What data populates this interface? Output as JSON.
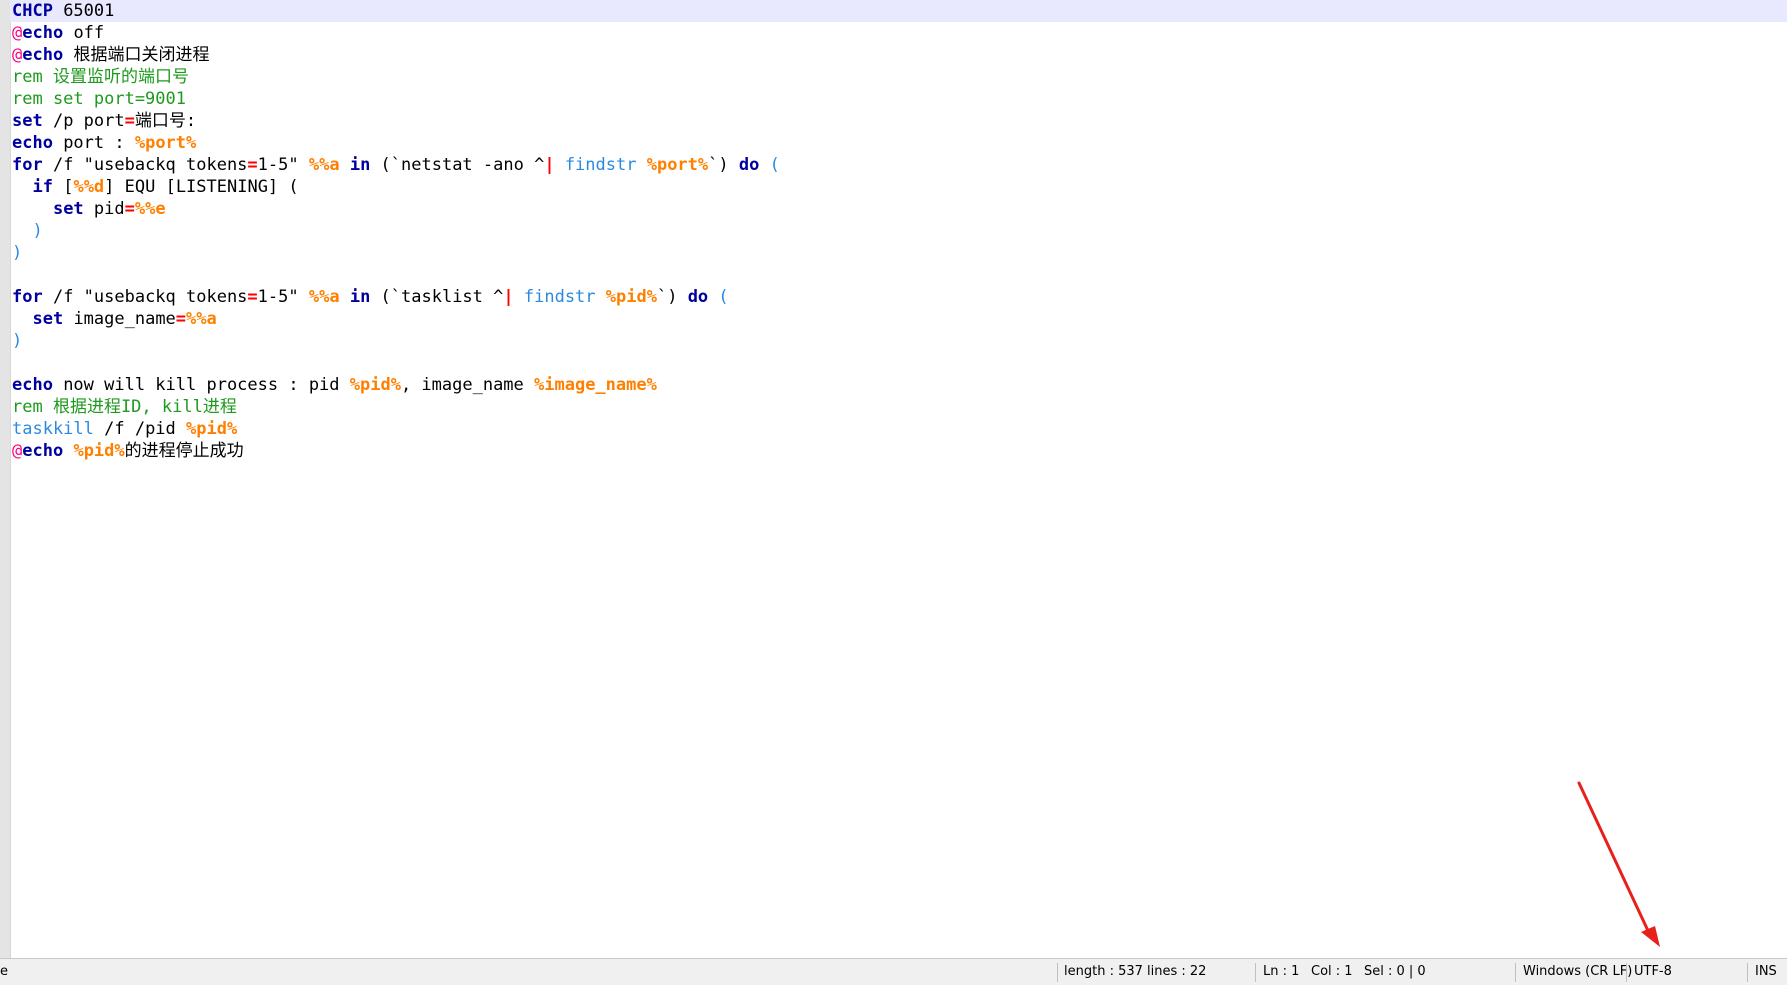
{
  "editor": {
    "lines": [
      [
        {
          "t": "CHCP",
          "c": "kw"
        },
        {
          "t": " 65001",
          "c": ""
        }
      ],
      [
        {
          "t": "@",
          "c": "at"
        },
        {
          "t": "echo",
          "c": "kw"
        },
        {
          "t": " off",
          "c": ""
        }
      ],
      [
        {
          "t": "@",
          "c": "at"
        },
        {
          "t": "echo",
          "c": "kw"
        },
        {
          "t": " 根据端口关闭进程",
          "c": ""
        }
      ],
      [
        {
          "t": "rem 设置监听的端口号",
          "c": "rem"
        }
      ],
      [
        {
          "t": "rem set port=9001",
          "c": "rem"
        }
      ],
      [
        {
          "t": "set",
          "c": "kw"
        },
        {
          "t": " /p port",
          "c": ""
        },
        {
          "t": "=",
          "c": "op"
        },
        {
          "t": "端口号:",
          "c": ""
        }
      ],
      [
        {
          "t": "echo",
          "c": "kw"
        },
        {
          "t": " port : ",
          "c": ""
        },
        {
          "t": "%port%",
          "c": "var"
        }
      ],
      [
        {
          "t": "for",
          "c": "kw"
        },
        {
          "t": " /f \"usebackq tokens",
          "c": ""
        },
        {
          "t": "=",
          "c": "op"
        },
        {
          "t": "1-5\" ",
          "c": ""
        },
        {
          "t": "%%a",
          "c": "var"
        },
        {
          "t": " ",
          "c": ""
        },
        {
          "t": "in",
          "c": "kw"
        },
        {
          "t": " (`netstat -ano ^",
          "c": ""
        },
        {
          "t": "|",
          "c": "pipe"
        },
        {
          "t": " ",
          "c": ""
        },
        {
          "t": "findstr",
          "c": "cmd"
        },
        {
          "t": " ",
          "c": ""
        },
        {
          "t": "%port%",
          "c": "var"
        },
        {
          "t": "`) ",
          "c": ""
        },
        {
          "t": "do",
          "c": "kw"
        },
        {
          "t": " ",
          "c": ""
        },
        {
          "t": "(",
          "c": "par"
        }
      ],
      [
        {
          "t": "  ",
          "c": ""
        },
        {
          "t": "if",
          "c": "kw"
        },
        {
          "t": " [",
          "c": ""
        },
        {
          "t": "%%d",
          "c": "var"
        },
        {
          "t": "] EQU [LISTENING] (",
          "c": ""
        }
      ],
      [
        {
          "t": "    ",
          "c": ""
        },
        {
          "t": "set",
          "c": "kw"
        },
        {
          "t": " pid",
          "c": ""
        },
        {
          "t": "=",
          "c": "op"
        },
        {
          "t": "%%e",
          "c": "var"
        }
      ],
      [
        {
          "t": "  ",
          "c": ""
        },
        {
          "t": ")",
          "c": "par"
        }
      ],
      [
        {
          "t": ")",
          "c": "par"
        }
      ],
      [
        {
          "t": "",
          "c": ""
        }
      ],
      [
        {
          "t": "for",
          "c": "kw"
        },
        {
          "t": " /f \"usebackq tokens",
          "c": ""
        },
        {
          "t": "=",
          "c": "op"
        },
        {
          "t": "1-5\" ",
          "c": ""
        },
        {
          "t": "%%a",
          "c": "var"
        },
        {
          "t": " ",
          "c": ""
        },
        {
          "t": "in",
          "c": "kw"
        },
        {
          "t": " (`tasklist ^",
          "c": ""
        },
        {
          "t": "|",
          "c": "pipe"
        },
        {
          "t": " ",
          "c": ""
        },
        {
          "t": "findstr",
          "c": "cmd"
        },
        {
          "t": " ",
          "c": ""
        },
        {
          "t": "%pid%",
          "c": "var"
        },
        {
          "t": "`) ",
          "c": ""
        },
        {
          "t": "do",
          "c": "kw"
        },
        {
          "t": " ",
          "c": ""
        },
        {
          "t": "(",
          "c": "par"
        }
      ],
      [
        {
          "t": "  ",
          "c": ""
        },
        {
          "t": "set",
          "c": "kw"
        },
        {
          "t": " image_name",
          "c": ""
        },
        {
          "t": "=",
          "c": "op"
        },
        {
          "t": "%%a",
          "c": "var"
        }
      ],
      [
        {
          "t": ")",
          "c": "par"
        }
      ],
      [
        {
          "t": "",
          "c": ""
        }
      ],
      [
        {
          "t": "echo",
          "c": "kw"
        },
        {
          "t": " now will kill process : pid ",
          "c": ""
        },
        {
          "t": "%pid%",
          "c": "var"
        },
        {
          "t": ", image_name ",
          "c": ""
        },
        {
          "t": "%image_name%",
          "c": "var"
        }
      ],
      [
        {
          "t": "rem 根据进程ID, kill进程",
          "c": "rem"
        }
      ],
      [
        {
          "t": "taskkill",
          "c": "cmd"
        },
        {
          "t": " /f /pid ",
          "c": ""
        },
        {
          "t": "%pid%",
          "c": "var"
        }
      ],
      [
        {
          "t": "@",
          "c": "at"
        },
        {
          "t": "echo",
          "c": "kw"
        },
        {
          "t": " ",
          "c": ""
        },
        {
          "t": "%pid%",
          "c": "var"
        },
        {
          "t": "的进程停止成功",
          "c": ""
        }
      ]
    ]
  },
  "statusbar": {
    "left_fragment": "e",
    "length": "length : 537",
    "lines": "lines : 22",
    "ln": "Ln : 1",
    "col": "Col : 1",
    "sel": "Sel : 0 | 0",
    "eol": "Windows (CR LF)",
    "encoding": "UTF-8",
    "mode": "INS"
  },
  "colors": {
    "keyword": "#0000a0",
    "comment": "#1e9a1e",
    "variable": "#ff8000",
    "operator": "#ff0000",
    "command": "#2b8ae0",
    "annotation_arrow": "#e8201c"
  },
  "annotation": {
    "icon": "red-arrow-icon"
  }
}
